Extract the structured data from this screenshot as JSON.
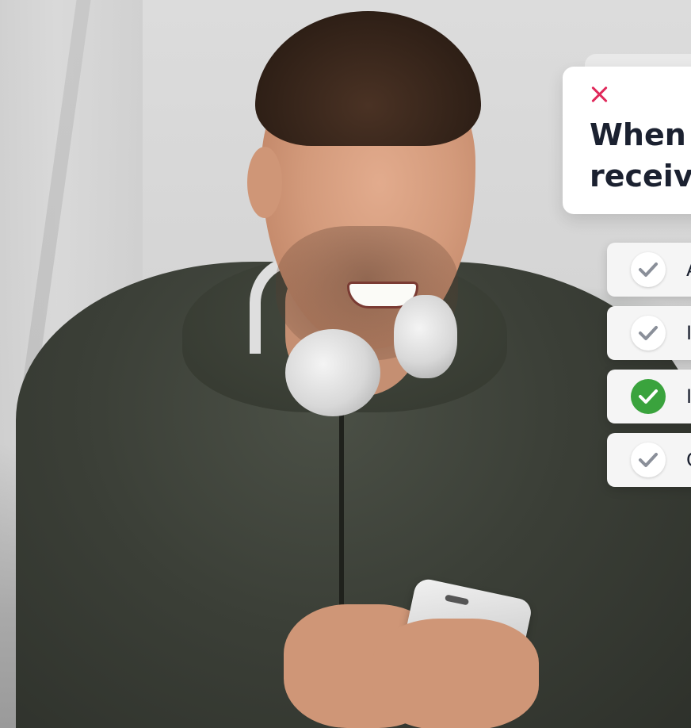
{
  "question": {
    "close_icon": "close-icon",
    "close_icon_color": "#e0285a",
    "lines": [
      "When",
      "receive"
    ]
  },
  "options": [
    {
      "label": "A",
      "selected": false
    },
    {
      "label": "I",
      "selected": false
    },
    {
      "label": "I",
      "selected": true
    },
    {
      "label": "C",
      "selected": false
    }
  ],
  "colors": {
    "check_selected": "#3aa33d",
    "check_default": "#ffffff",
    "text": "#1b2130"
  }
}
